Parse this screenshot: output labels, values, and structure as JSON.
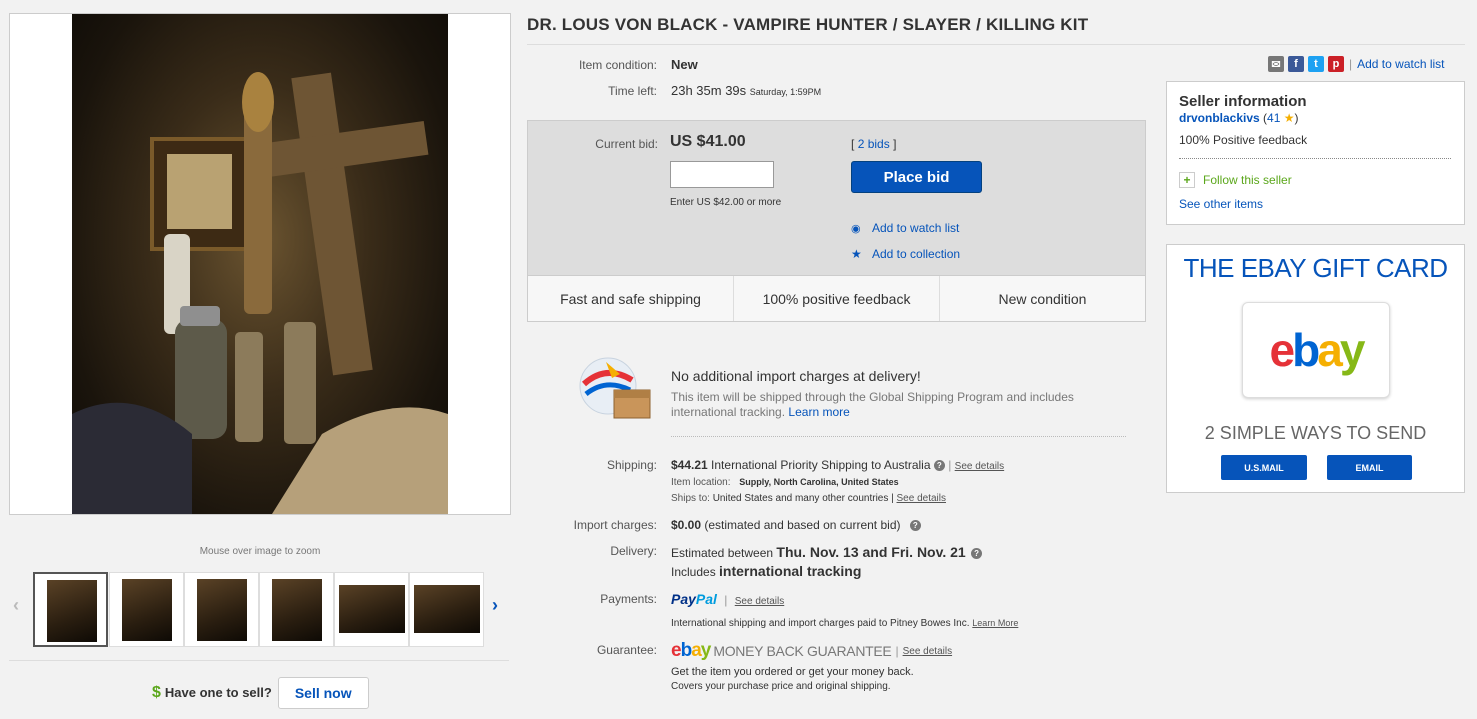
{
  "title": "DR. LOUS VON BLACK - VAMPIRE HUNTER / SLAYER / KILLING KIT",
  "gallery": {
    "zoom_hint": "Mouse over image to zoom",
    "thumbnail_count": 6,
    "selected_thumbnail": 1
  },
  "sell": {
    "prompt": "Have one to sell?",
    "button": "Sell now",
    "currency_symbol": "$"
  },
  "item": {
    "condition_label": "Item condition:",
    "condition_value": "New",
    "time_left_label": "Time left:",
    "time_left_value": "23h 35m 39s",
    "time_left_end": "Saturday, 1:59PM"
  },
  "bid": {
    "current_label": "Current bid:",
    "current_value": "US $41.00",
    "bids_open": "[",
    "bids_link": "2 bids",
    "bids_close": "]",
    "input_hint": "Enter US $42.00 or more",
    "place_bid": "Place bid",
    "watch": "Add to watch list",
    "collection": "Add to collection",
    "features": [
      "Fast and safe shipping",
      "100% positive feedback",
      "New condition"
    ]
  },
  "import_notice": {
    "title": "No additional import charges at delivery!",
    "body": "This item will be shipped through the Global Shipping Program and includes international tracking.",
    "learn_more": "Learn more"
  },
  "shipping": {
    "label": "Shipping:",
    "cost": "$44.21",
    "service": "International Priority Shipping to Australia",
    "sep": "|",
    "see_details": "See details",
    "location_label": "Item location:",
    "location_value": "Supply, North Carolina, United States",
    "ships_to_label": "Ships to:",
    "ships_to_value": "United States and many other countries |",
    "ships_to_details": "See details"
  },
  "import_charges": {
    "label": "Import charges:",
    "value": "$0.00",
    "note": "(estimated and based on current bid)"
  },
  "delivery": {
    "label": "Delivery:",
    "prefix": "Estimated between",
    "range": "Thu. Nov. 13 and Fri. Nov. 21",
    "tracking_prefix": "Includes",
    "tracking": "international tracking"
  },
  "payments": {
    "label": "Payments:",
    "pay": "Pay",
    "pal": "Pal",
    "sep": "|",
    "see_details": "See details",
    "note": "International shipping and import charges paid to Pitney Bowes Inc.",
    "learn_more": "Learn More"
  },
  "guarantee": {
    "label": "Guarantee:",
    "brand": "MONEY BACK GUARANTEE",
    "sep": "|",
    "see_details": "See details",
    "line1": "Get the item you ordered or get your money back.",
    "line2": "Covers your purchase price and original shipping."
  },
  "share": {
    "watch": "Add to watch list",
    "sep": "|",
    "colors": {
      "email": "#777777",
      "facebook": "#3b5998",
      "twitter": "#1da1f2",
      "pinterest": "#cb2027"
    }
  },
  "seller": {
    "heading": "Seller information",
    "name": "drvonblackivs",
    "score_open": "(",
    "score": "41",
    "score_close": ")",
    "feedback": "100% Positive feedback",
    "follow": "Follow this seller",
    "other_items": "See other items"
  },
  "gift_card": {
    "title": "THE EBAY GIFT CARD",
    "logo": {
      "e": "e",
      "b": "b",
      "a": "a",
      "y": "y"
    },
    "subtitle": "2 SIMPLE WAYS TO SEND",
    "options": [
      "U.S.MAIL",
      "EMAIL"
    ]
  },
  "colors": {
    "accent": "#0654ba",
    "ebay_red": "#e53238",
    "ebay_blue": "#0064d2",
    "ebay_yellow": "#f5af02",
    "ebay_green": "#86b817"
  }
}
